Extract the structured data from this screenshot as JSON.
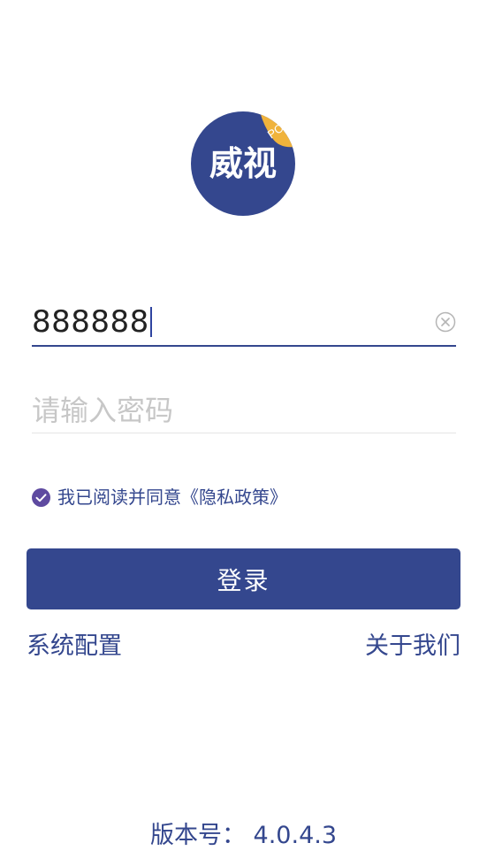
{
  "logo": {
    "text": "威视",
    "badge": "PC",
    "bg_color": "#34478e",
    "badge_color": "#f0b33c"
  },
  "login_form": {
    "username_value": "888888",
    "password_placeholder": "请输入密码",
    "agreement_checked": true,
    "agreement_text": "我已阅读并同意《隐私政策》",
    "login_label": "登录"
  },
  "links": {
    "system_config": "系统配置",
    "about_us": "关于我们"
  },
  "version_text": "版本号： 4.0.4.3",
  "colors": {
    "primary": "#34478e",
    "checkbox": "#5e4aa0"
  }
}
